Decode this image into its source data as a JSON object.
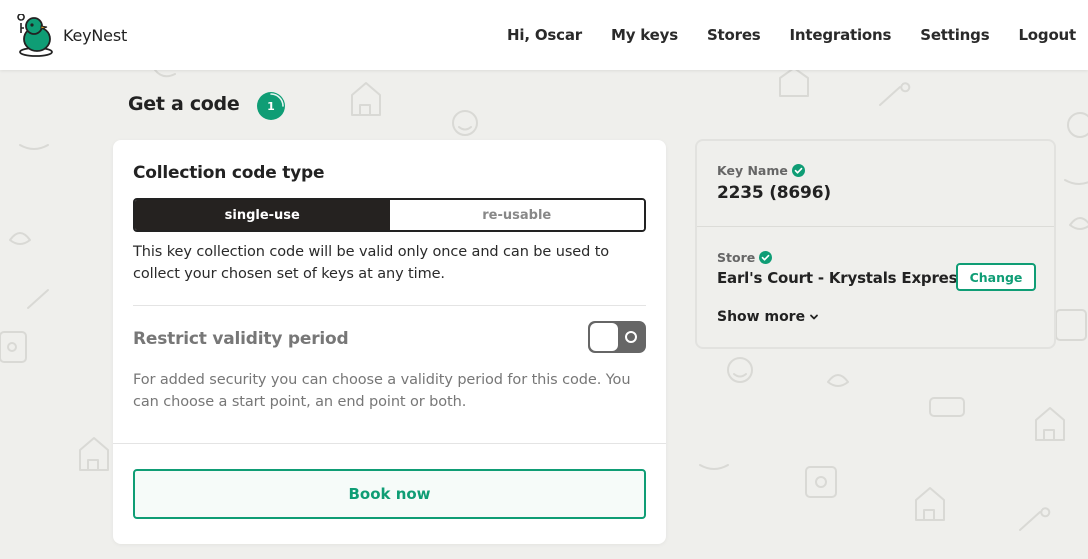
{
  "brand": {
    "name": "KeyNest",
    "logo_icon": "bird-key-logo-icon",
    "accent": "#0f9d75"
  },
  "nav": {
    "greeting": "Hi, Oscar",
    "items": [
      {
        "label": "My keys"
      },
      {
        "label": "Stores"
      },
      {
        "label": "Integrations"
      },
      {
        "label": "Settings"
      },
      {
        "label": "Logout"
      }
    ]
  },
  "page": {
    "title": "Get a code",
    "step": "1"
  },
  "code_card": {
    "section_title": "Collection code type",
    "options": [
      {
        "label": "single-use",
        "selected": true
      },
      {
        "label": "re-usable",
        "selected": false
      }
    ],
    "description": "This key collection code will be valid only once and can be used to collect your chosen set of keys at any time.",
    "restrict": {
      "title": "Restrict validity period",
      "enabled": false,
      "description": "For added security you can choose a validity period for this code. You can choose a start point, an end point or both."
    },
    "book_label": "Book now"
  },
  "summary": {
    "key_label": "Key Name",
    "key_value": "2235 (8696)",
    "store_label": "Store",
    "store_value": "Earl's Court - Krystals Express",
    "change_label": "Change",
    "show_more_label": "Show more"
  }
}
